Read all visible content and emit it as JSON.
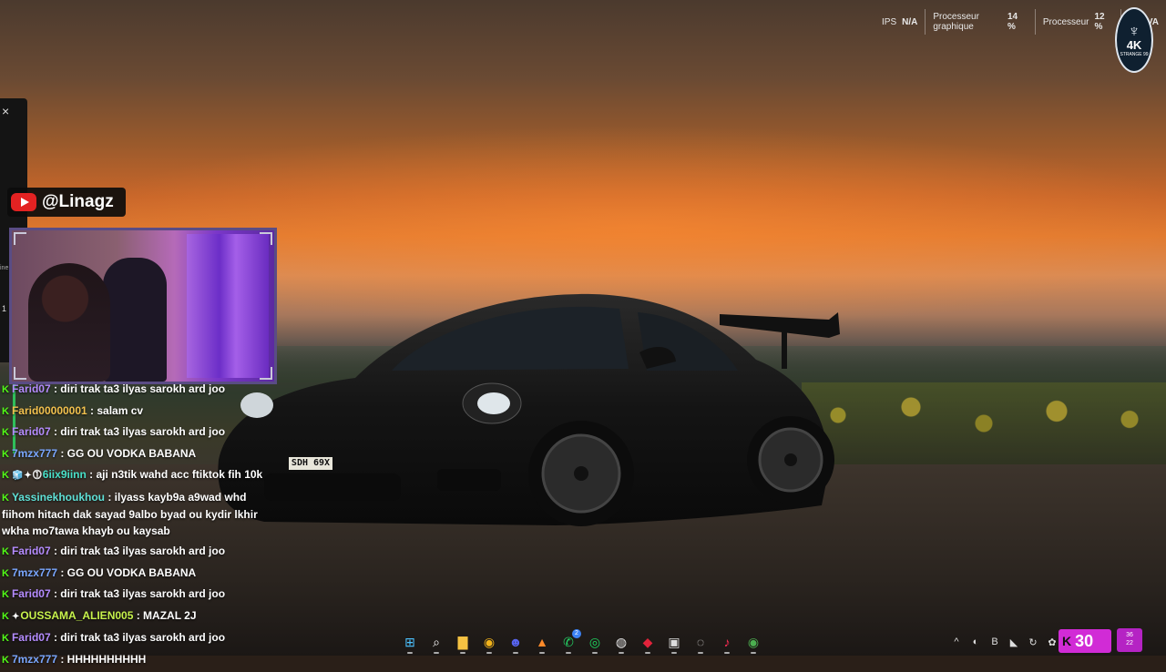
{
  "stats": [
    {
      "label": "IPS",
      "value": "N/A"
    },
    {
      "label": "Processeur graphique",
      "value": "14 %"
    },
    {
      "label": "Processeur",
      "value": "12 %"
    },
    {
      "label": "",
      "value": "VA"
    }
  ],
  "logo": {
    "text": "4K",
    "subtext": "STRANGE 99"
  },
  "left_panel": {
    "close_icon": "×",
    "side_text": "ine",
    "side_number": "1"
  },
  "youtube": {
    "handle": "@Linagz"
  },
  "car": {
    "plate": "SDH 69X"
  },
  "chat": [
    {
      "user": "Farid07",
      "color": "purple",
      "badges": [],
      "text": " : diri trak ta3 ilyas sarokh ard joo"
    },
    {
      "user": "Farid00000001",
      "color": "yellow",
      "badges": [],
      "text": " : salam cv"
    },
    {
      "user": "Farid07",
      "color": "purple",
      "badges": [],
      "text": " : diri trak ta3 ilyas sarokh ard joo"
    },
    {
      "user": "7mzx777",
      "color": "blue",
      "badges": [],
      "text": " : GG OU VODKA BABANA"
    },
    {
      "user": "6iix9iinn",
      "color": "cyan",
      "badges": [
        "🧊",
        "✦",
        "⓵"
      ],
      "text": " : aji n3tik wahd acc ftiktok fih 10k"
    },
    {
      "user": "Yassinekhoukhou",
      "color": "teal",
      "badges": [],
      "text": " : ilyass kayb9a a9wad whd fiihom hitach dak sayad 9albo byad ou kydir lkhir wkha mo7tawa khayb ou kaysab"
    },
    {
      "user": "Farid07",
      "color": "purple",
      "badges": [],
      "text": " : diri trak ta3 ilyas sarokh ard joo"
    },
    {
      "user": "7mzx777",
      "color": "blue",
      "badges": [],
      "text": " : GG OU VODKA BABANA"
    },
    {
      "user": "Farid07",
      "color": "purple",
      "badges": [],
      "text": " : diri trak ta3 ilyas sarokh ard joo"
    },
    {
      "user": "OUSSAMA_ALIEN005",
      "color": "lime",
      "badges": [
        "✦"
      ],
      "text": " : MAZAL 2J"
    },
    {
      "user": "Farid07",
      "color": "purple",
      "badges": [],
      "text": " : diri trak ta3 ilyas sarokh ard joo"
    },
    {
      "user": "7mzx777",
      "color": "blue",
      "badges": [],
      "text": " : HHHHHHHHHH"
    }
  ],
  "taskbar": {
    "apps": [
      {
        "name": "windows-start-icon",
        "glyph": "⊞",
        "color": "#4cc2ff"
      },
      {
        "name": "search-icon",
        "glyph": "⌕",
        "color": "#ffffff"
      },
      {
        "name": "file-explorer-icon",
        "glyph": "▇",
        "color": "#f5c242"
      },
      {
        "name": "chrome-icon",
        "glyph": "◉",
        "color": "#f2b31b"
      },
      {
        "name": "discord-icon",
        "glyph": "☻",
        "color": "#5865f2"
      },
      {
        "name": "app-a-icon",
        "glyph": "▲",
        "color": "#ff8a2a"
      },
      {
        "name": "whatsapp-icon",
        "glyph": "✆",
        "color": "#25d366",
        "badge": "2"
      },
      {
        "name": "spotify-icon",
        "glyph": "◎",
        "color": "#1ed760"
      },
      {
        "name": "obs-icon",
        "glyph": "◍",
        "color": "#e6e6e6"
      },
      {
        "name": "app-red-icon",
        "glyph": "◆",
        "color": "#e2233b"
      },
      {
        "name": "app-dark-icon",
        "glyph": "▣",
        "color": "#dddddd"
      },
      {
        "name": "app-circle-icon",
        "glyph": "◌",
        "color": "#dddddd"
      },
      {
        "name": "tiktok-icon",
        "glyph": "♪",
        "color": "#ff2c55"
      },
      {
        "name": "chrome-profile-icon",
        "glyph": "◉",
        "color": "#4caf50"
      }
    ],
    "tray": [
      {
        "name": "chevron-up-icon",
        "glyph": "^"
      },
      {
        "name": "tray-app-icon",
        "glyph": "◐"
      },
      {
        "name": "bluetooth-icon",
        "glyph": "B"
      },
      {
        "name": "nvidia-icon",
        "glyph": "◣"
      },
      {
        "name": "sync-icon",
        "glyph": "↻"
      },
      {
        "name": "app-settings-icon",
        "glyph": "✿"
      },
      {
        "name": "mic-icon",
        "glyph": "🎙"
      }
    ],
    "kick_viewers": "30",
    "kick_counter_top": "36",
    "kick_counter_bottom": "22"
  },
  "colors": {
    "kick_green": "#53fc18",
    "kick_widget": "#d12bd6"
  }
}
